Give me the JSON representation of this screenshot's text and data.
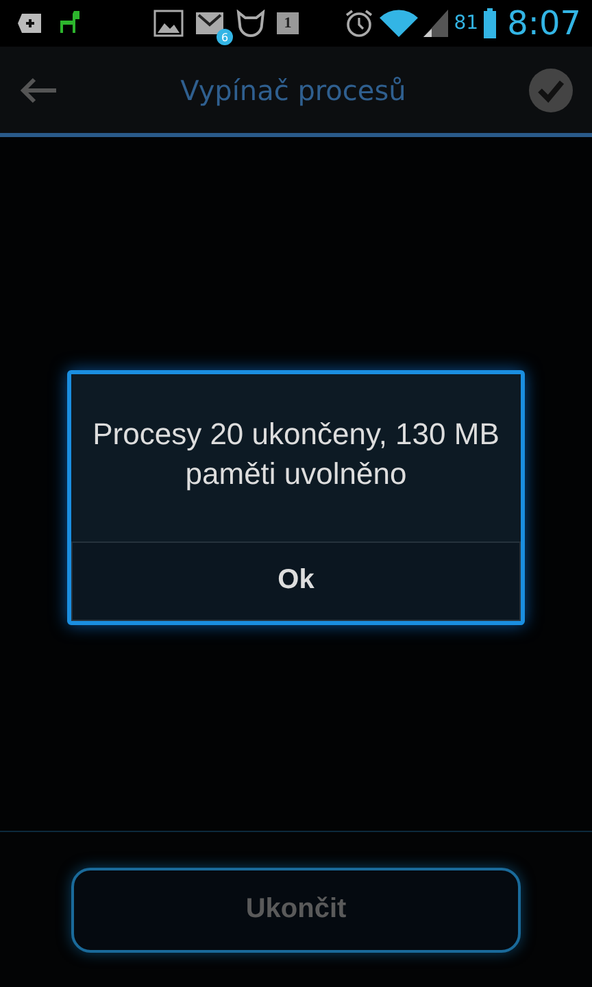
{
  "status_bar": {
    "mail_badge": "6",
    "calendar_day": "1",
    "battery": "81",
    "time": "8:07"
  },
  "header": {
    "title": "Vypínač procesů"
  },
  "dialog": {
    "message": "Procesy 20 ukončeny, 130 MB paměti uvolněno",
    "button": "Ok"
  },
  "footer": {
    "button": "Ukončit",
    "disabled": true
  }
}
